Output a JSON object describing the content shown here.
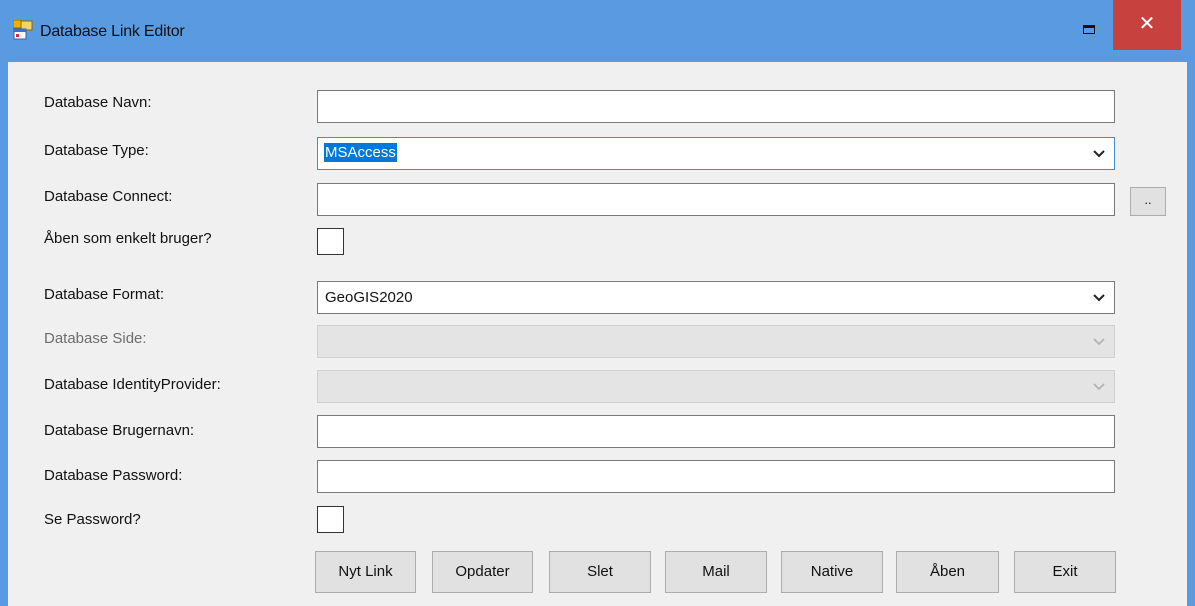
{
  "window": {
    "title": "Database Link Editor",
    "close_glyph": "✕",
    "maximize_icon": "maximize-icon",
    "app_icon": "app-forms-icon"
  },
  "colors": {
    "titlebar": "#5a9ae0",
    "close": "#c7413e",
    "client": "#f0f0f0",
    "selection": "#0078d7"
  },
  "form": {
    "name": {
      "label": "Database Navn:",
      "value": ""
    },
    "type": {
      "label": "Database Type:",
      "value": "MSAccess"
    },
    "connect": {
      "label": "Database Connect:",
      "value": "",
      "browse_label": ".."
    },
    "single_user": {
      "label": "Åben som enkelt bruger?",
      "checked": false
    },
    "format": {
      "label": "Database Format:",
      "value": "GeoGIS2020"
    },
    "side": {
      "label": "Database Side:",
      "value": "",
      "enabled": false
    },
    "identity_provider": {
      "label": "Database IdentityProvider:",
      "value": "",
      "enabled": false
    },
    "username": {
      "label": "Database Brugernavn:",
      "value": ""
    },
    "password": {
      "label": "Database Password:",
      "value": ""
    },
    "show_password": {
      "label": "Se Password?",
      "checked": false
    }
  },
  "buttons": {
    "new_link": "Nyt Link",
    "update": "Opdater",
    "delete": "Slet",
    "mail": "Mail",
    "native": "Native",
    "open": "Åben",
    "exit": "Exit"
  }
}
